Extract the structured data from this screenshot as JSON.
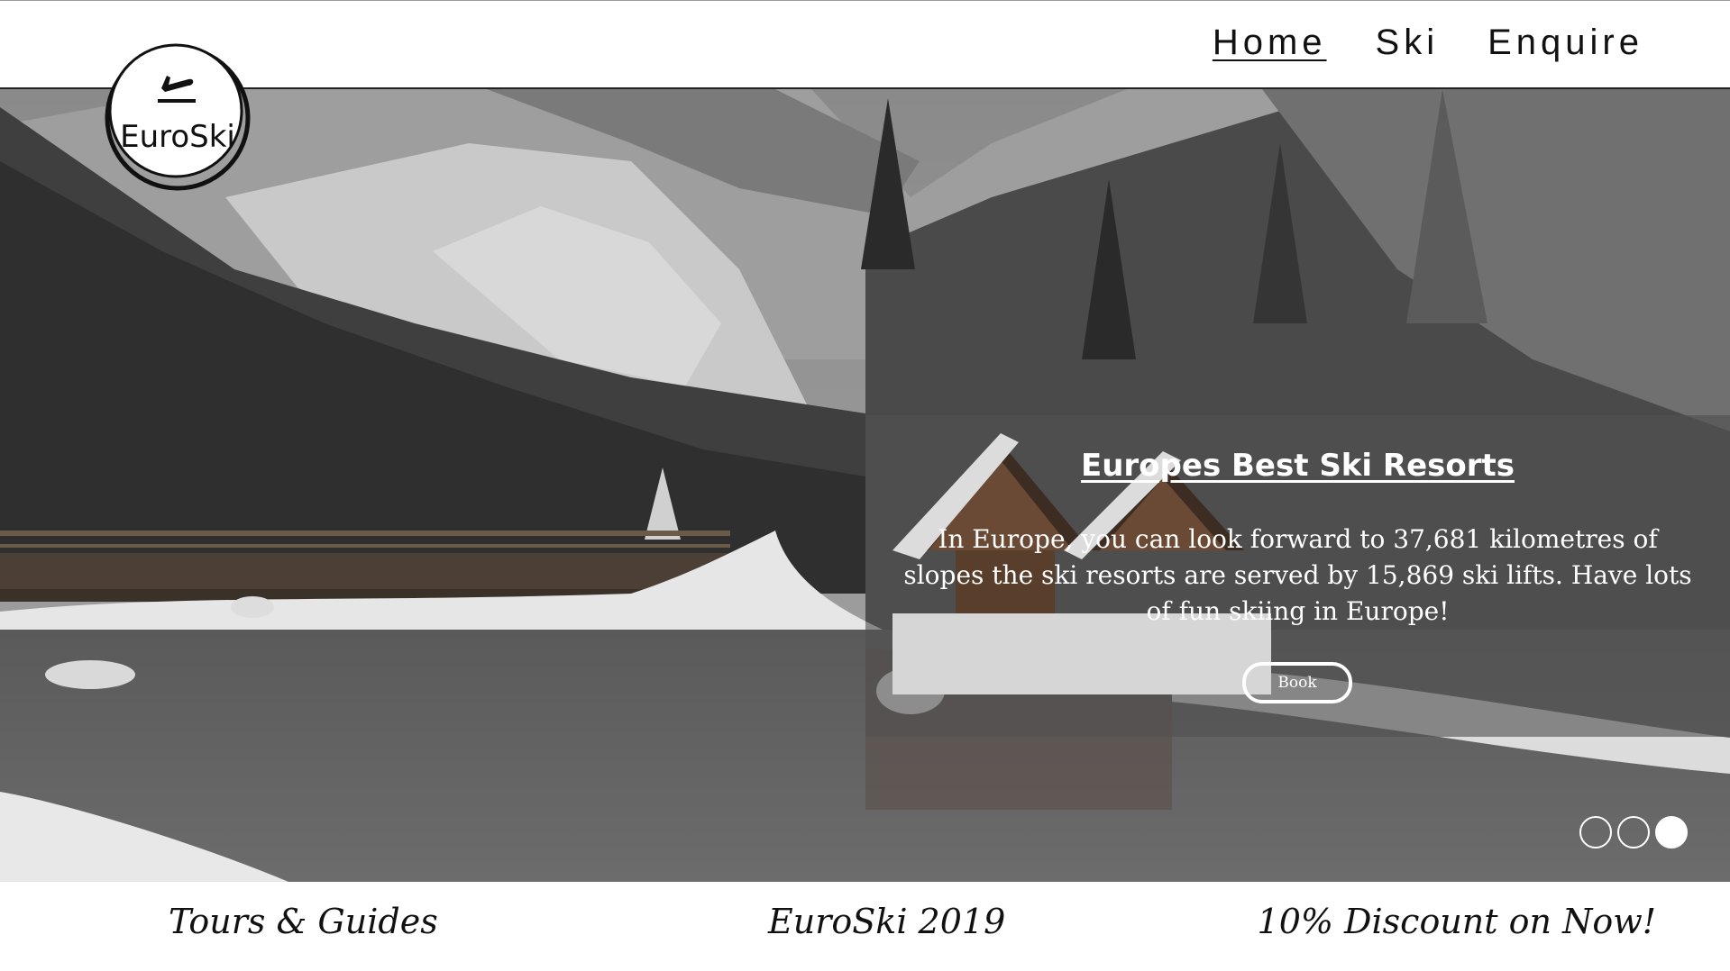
{
  "header": {
    "nav": [
      "Home",
      "Ski",
      "Enquire"
    ],
    "active": "Home"
  },
  "logo": {
    "text": "EuroSki",
    "icon": "airplane-departure-icon"
  },
  "hero": {
    "title": "Europes Best Ski Resorts",
    "text": "In Europe, you can look forward to 37,681 kilometres of slopes the ski resorts are served by 15,869 ski lifts. Have lots of fun skiing in Europe!",
    "button": "Book",
    "slides": {
      "count": 3,
      "active_index": 3
    }
  },
  "footer": {
    "left": "Tours & Guides",
    "center": "EuroSki 2019",
    "right": "10% Discount on Now!"
  },
  "colors": {
    "panel_overlay": "#505050",
    "text_on_dark": "#ffffff",
    "ink": "#111111"
  }
}
